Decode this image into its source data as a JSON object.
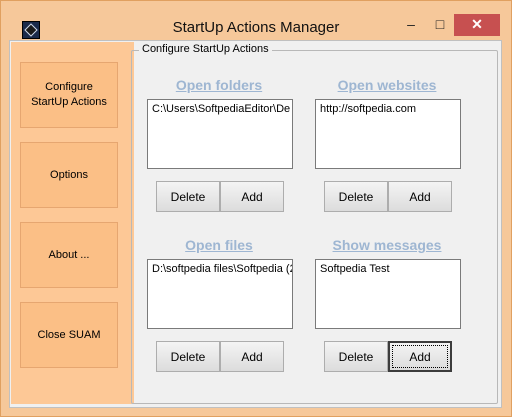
{
  "window": {
    "title": "StartUp Actions Manager",
    "minimize_glyph": "–",
    "maximize_glyph": "□",
    "close_glyph": "✕"
  },
  "sidebar": {
    "items": [
      {
        "label": "Configure\nStartUp Actions"
      },
      {
        "label": "Options"
      },
      {
        "label": "About ..."
      },
      {
        "label": "Close SUAM"
      }
    ]
  },
  "group": {
    "title": "Configure StartUp Actions"
  },
  "sections": {
    "open_folders": {
      "title": "Open folders",
      "items": [
        "C:\\Users\\SoftpediaEditor\\De"
      ],
      "delete_label": "Delete",
      "add_label": "Add"
    },
    "open_websites": {
      "title": "Open websites",
      "items": [
        "http://softpedia.com"
      ],
      "delete_label": "Delete",
      "add_label": "Add"
    },
    "open_files": {
      "title": "Open files",
      "items": [
        "D:\\softpedia files\\Softpedia (2"
      ],
      "delete_label": "Delete",
      "add_label": "Add"
    },
    "show_messages": {
      "title": "Show messages",
      "items": [
        "Softpedia Test"
      ],
      "delete_label": "Delete",
      "add_label": "Add"
    }
  },
  "colors": {
    "accent": "#f6c89a",
    "section_title": "#9eb6d2",
    "close_button": "#c75050"
  },
  "icons": {
    "app": "app-icon",
    "minimize": "minimize-icon",
    "maximize": "maximize-icon",
    "close": "close-icon"
  }
}
